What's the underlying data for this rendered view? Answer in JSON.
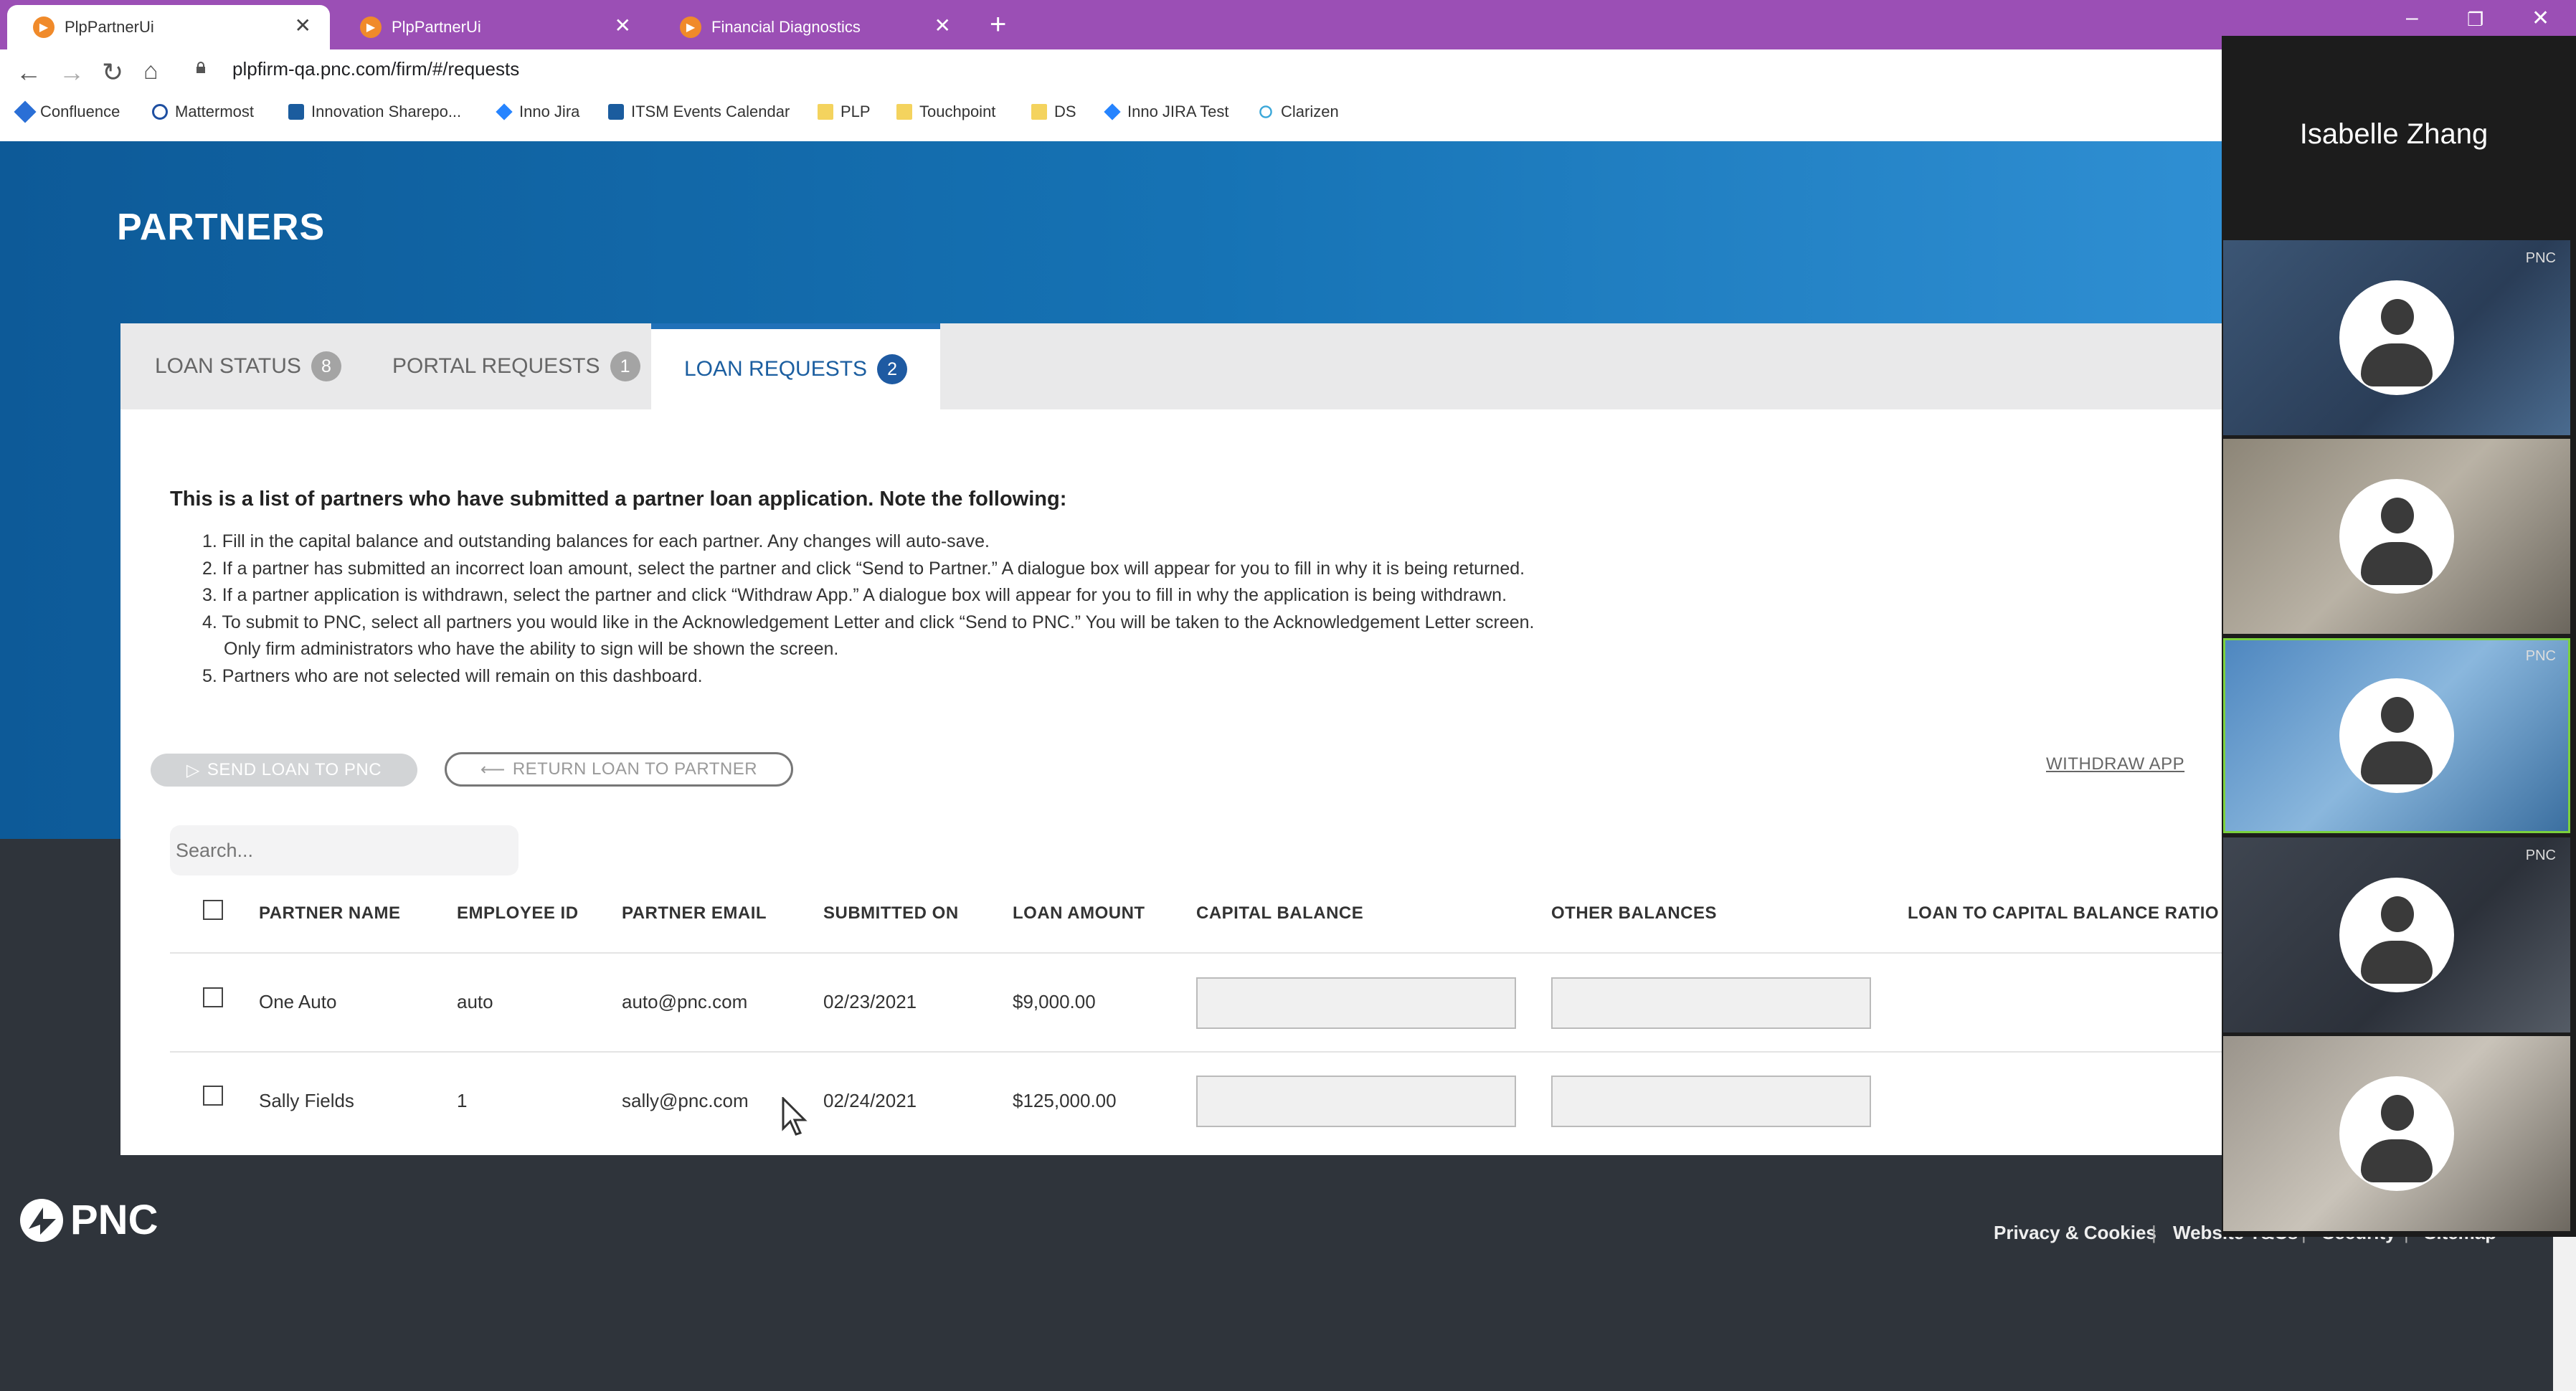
{
  "browser": {
    "tabs": [
      {
        "title": "PlpPartnerUi",
        "active": true
      },
      {
        "title": "PlpPartnerUi",
        "active": false
      },
      {
        "title": "Financial Diagnostics",
        "active": false
      }
    ],
    "url": "plpfirm-qa.pnc.com/firm/#/requests",
    "bookmarks": [
      "Confluence",
      "Mattermost",
      "Innovation Sharepo...",
      "Inno Jira",
      "ITSM Events Calendar",
      "PLP",
      "Touchpoint",
      "DS",
      "Inno JIRA Test",
      "Clarizen"
    ]
  },
  "page": {
    "title": "PARTNERS",
    "tabs": [
      {
        "label": "LOAN STATUS",
        "count": "8"
      },
      {
        "label": "PORTAL REQUESTS",
        "count": "1"
      },
      {
        "label": "LOAN REQUESTS",
        "count": "2"
      }
    ],
    "intro": "This is a list of partners who have submitted a partner loan application. Note the following:",
    "instructions": [
      "1. Fill in the capital balance and outstanding balances for each partner. Any changes will auto-save.",
      "2. If a partner has submitted an incorrect loan amount, select the partner and click “Send to Partner.” A dialogue box will appear for you to fill in why it is being returned.",
      "3. If a partner application is withdrawn, select the partner and click “Withdraw App.” A dialogue box will appear for you to fill in why the application is being withdrawn.",
      "4. To submit to PNC, select all partners you would like in the Acknowledgement Letter and click “Send to PNC.” You will be taken to the Acknowledgement Letter screen.",
      "Only firm administrators who have the ability to sign will be shown the screen.",
      "5. Partners who are not selected will remain on this dashboard."
    ],
    "actions": {
      "send": "SEND LOAN TO PNC",
      "return": "RETURN LOAN TO PARTNER",
      "withdraw": "WITHDRAW APP"
    },
    "search_placeholder": "Search...",
    "table": {
      "columns": [
        "PARTNER NAME",
        "EMPLOYEE ID",
        "PARTNER EMAIL",
        "SUBMITTED ON",
        "LOAN AMOUNT",
        "CAPITAL BALANCE",
        "OTHER BALANCES",
        "LOAN TO CAPITAL BALANCE RATIO"
      ],
      "rows": [
        {
          "name": "One Auto",
          "employee_id": "auto",
          "email": "auto@pnc.com",
          "submitted": "02/23/2021",
          "amount": "$9,000.00",
          "capital_balance": "",
          "other_balances": ""
        },
        {
          "name": "Sally Fields",
          "employee_id": "1",
          "email": "sally@pnc.com",
          "submitted": "02/24/2021",
          "amount": "$125,000.00",
          "capital_balance": "",
          "other_balances": ""
        }
      ]
    }
  },
  "footer": {
    "brand": "PNC",
    "links": [
      "Privacy & Cookies",
      "Website T&Cs",
      "Security",
      "Sitemap"
    ]
  },
  "video_call": {
    "speaker": "Isabelle Zhang",
    "tile_watermark": "PNC"
  }
}
